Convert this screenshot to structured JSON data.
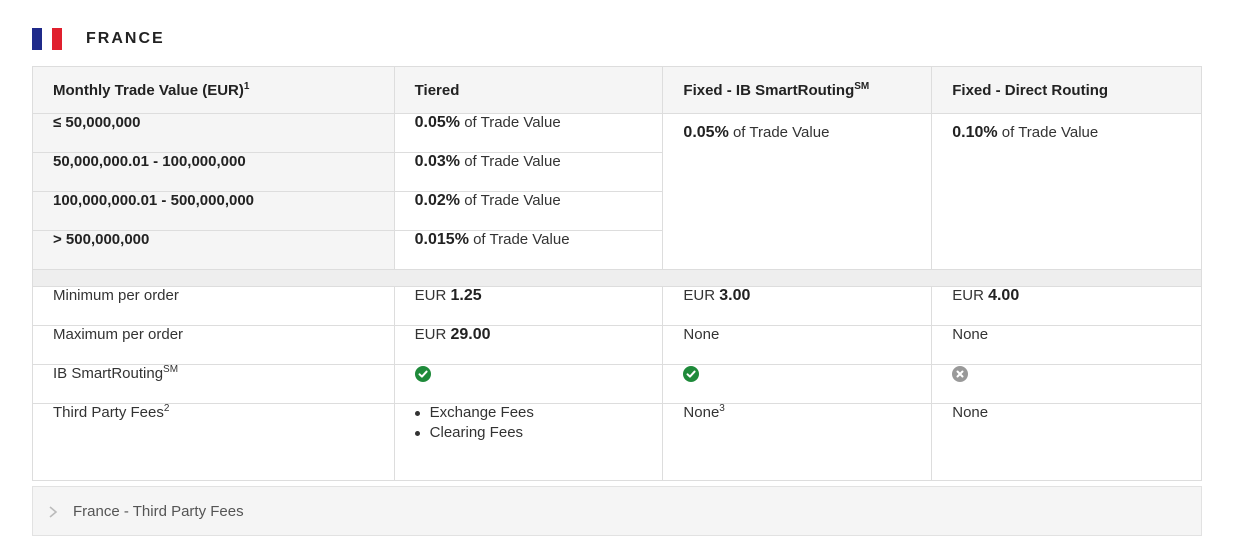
{
  "country": {
    "name": "FRANCE",
    "flag_colors": [
      "#1f2a8a",
      "#ffffff",
      "#e0202e"
    ]
  },
  "table": {
    "headers": {
      "col1": "Monthly Trade Value (EUR)",
      "col1_sup": "1",
      "col2": "Tiered",
      "col3": "Fixed - IB SmartRouting",
      "col3_sup": "SM",
      "col4": "Fixed - Direct Routing"
    },
    "tiers": [
      {
        "range": "≤ 50,000,000",
        "rate": "0.05%",
        "suffix": "of Trade Value"
      },
      {
        "range": "50,000,000.01 - 100,000,000",
        "rate": "0.03%",
        "suffix": "of Trade Value"
      },
      {
        "range": "100,000,000.01 - 500,000,000",
        "rate": "0.02%",
        "suffix": "of Trade Value"
      },
      {
        "range": "> 500,000,000",
        "rate": "0.015%",
        "suffix": "of Trade Value"
      }
    ],
    "fixed_smart": {
      "rate": "0.05%",
      "suffix": "of Trade Value"
    },
    "fixed_direct": {
      "rate": "0.10%",
      "suffix": "of Trade Value"
    },
    "min_order": {
      "label": "Minimum per order",
      "currency": "EUR",
      "tiered": "1.25",
      "smart": "3.00",
      "direct": "4.00"
    },
    "max_order": {
      "label": "Maximum per order",
      "currency": "EUR",
      "tiered": "29.00",
      "smart": "None",
      "direct": "None"
    },
    "smart_routing": {
      "label": "IB SmartRouting",
      "sup": "SM",
      "tiered": "check",
      "smart": "check",
      "direct": "x"
    },
    "third_party": {
      "label": "Third Party Fees",
      "sup": "2",
      "tiered_items": [
        "Exchange Fees",
        "Clearing Fees"
      ],
      "smart": "None",
      "smart_sup": "3",
      "direct": "None"
    }
  },
  "accordion": {
    "label": "France - Third Party Fees"
  },
  "colors": {
    "check_green": "#1e8a3a",
    "x_gray": "#999999"
  }
}
